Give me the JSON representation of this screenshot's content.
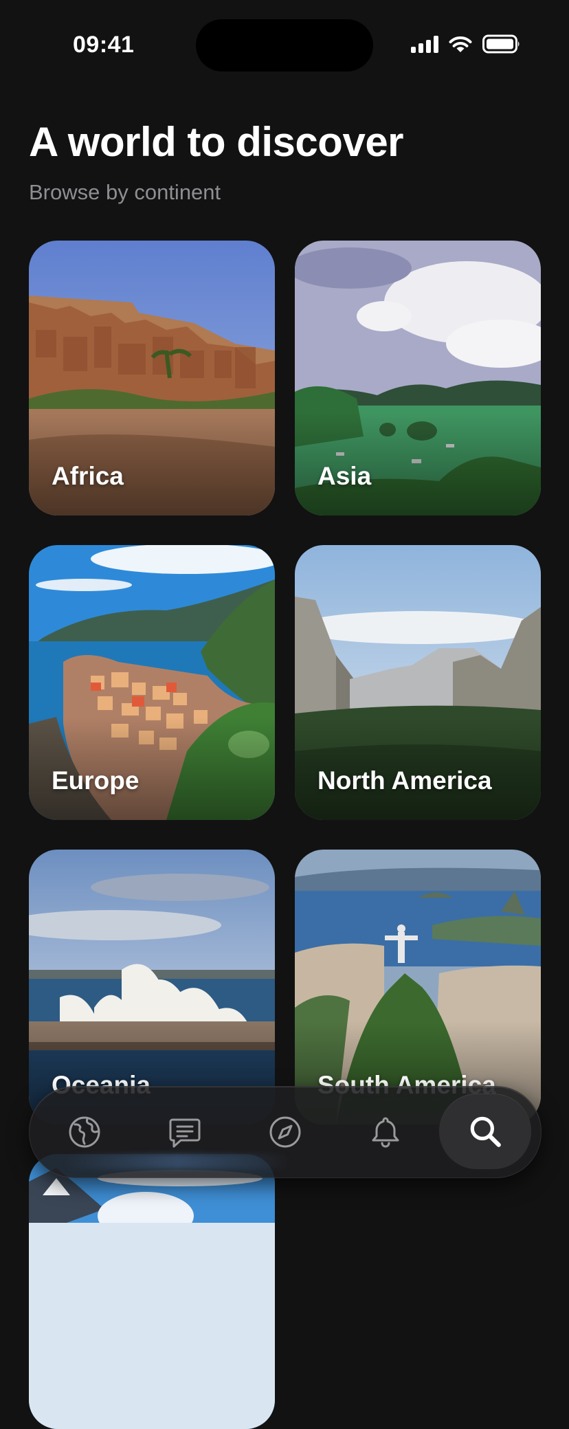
{
  "status_bar": {
    "time": "09:41",
    "icons": [
      "signal-icon",
      "wifi-icon",
      "battery-icon"
    ]
  },
  "header": {
    "title": "A world to discover",
    "subtitle": "Browse by continent"
  },
  "continents": [
    {
      "label": "Africa",
      "image": "kasbah-desert-village"
    },
    {
      "label": "Asia",
      "image": "bay-with-limestone-islands"
    },
    {
      "label": "Europe",
      "image": "coastal-cliff-village"
    },
    {
      "label": "North America",
      "image": "granite-valley-cliffs"
    },
    {
      "label": "Oceania",
      "image": "opera-house-harbour"
    },
    {
      "label": "South America",
      "image": "statue-on-mountain-bay"
    },
    {
      "label": "",
      "image": "snowy-mountains"
    }
  ],
  "tab_bar": {
    "items": [
      {
        "icon": "globe-icon",
        "active": false
      },
      {
        "icon": "chat-icon",
        "active": false
      },
      {
        "icon": "compass-icon",
        "active": false
      },
      {
        "icon": "bell-icon",
        "active": false
      },
      {
        "icon": "search-icon",
        "active": true
      }
    ]
  },
  "colors": {
    "background": "#121212",
    "subtitle": "#8e8e93",
    "active_tab": "#2f2f31",
    "text": "#ffffff"
  }
}
